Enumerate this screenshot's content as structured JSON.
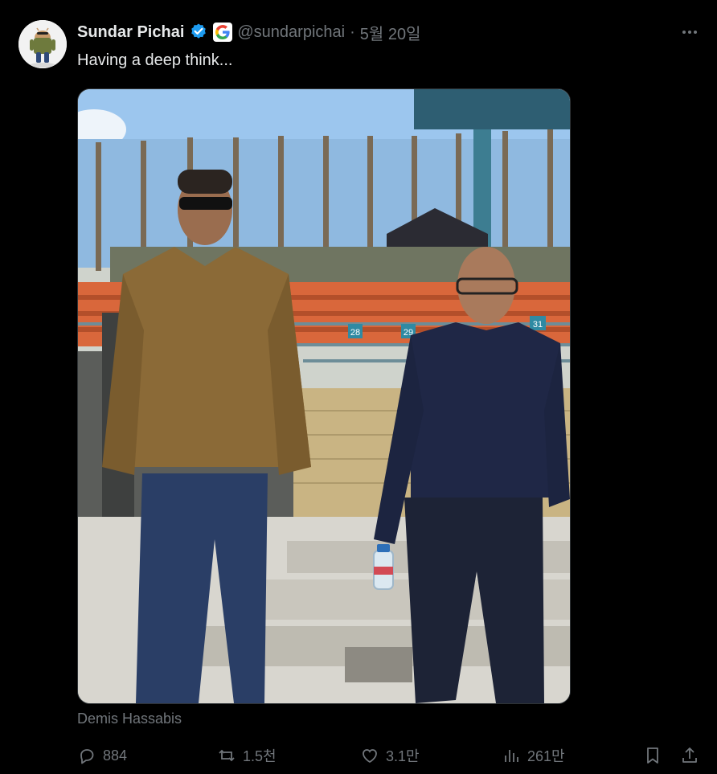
{
  "author": {
    "display_name": "Sundar Pichai",
    "handle": "@sundarpichai",
    "date": "5월 20일",
    "separator": "·",
    "verified": true,
    "affiliation_badge": "google-g-icon"
  },
  "tweet": {
    "text": "Having a deep think..."
  },
  "media": {
    "tagged_user": "Demis Hassabis",
    "seat_numbers": [
      "28",
      "29",
      "31"
    ]
  },
  "actions": {
    "replies": "884",
    "reposts": "1.5천",
    "likes": "3.1만",
    "views": "261만"
  },
  "colors": {
    "background": "#000000",
    "primary_text": "#e7e9ea",
    "secondary_text": "#71767b",
    "verified_blue": "#1d9bf0"
  }
}
